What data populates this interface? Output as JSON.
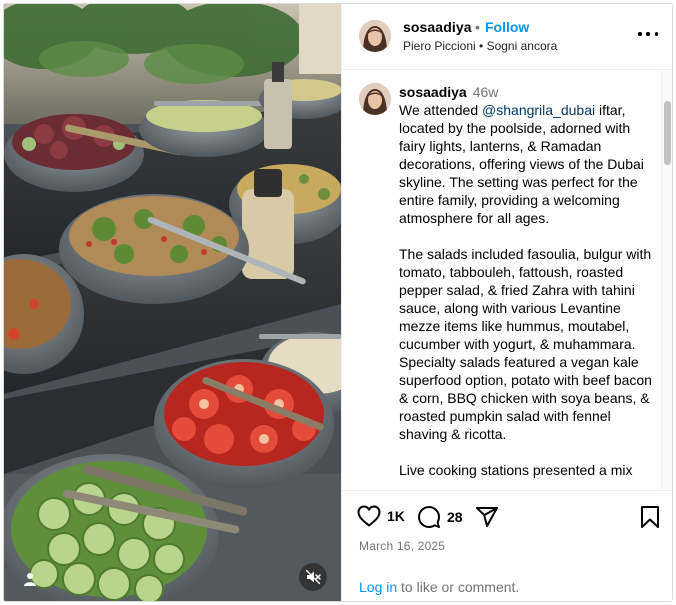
{
  "colors": {
    "link_blue": "#0095f6",
    "mention_blue": "#00376b",
    "muted_gray": "#737373",
    "border": "#dbdbdb"
  },
  "header": {
    "username": "sosaadiya",
    "separator": "•",
    "follow_label": "Follow",
    "audio": "Piero Piccioni • Sogni ancora",
    "more_icon": "more-horizontal-icon"
  },
  "caption": {
    "username": "sosaadiya",
    "time": "46w",
    "p1_before": "We attended ",
    "mention": "@shangrila_dubai",
    "p1_after": " iftar, located by the poolside, adorned with fairy lights, lanterns, & Ramadan decorations, offering views of the Dubai skyline. The setting was perfect for the entire family, providing a welcoming atmosphere for all ages.",
    "p2": "The salads included fasoulia, bulgur with tomato, tabbouleh, fattoush, roasted pepper salad, & fried Zahra with tahini sauce, along with various Levantine mezze items like hummus, moutabel, cucumber with yogurt, & muhammara. Specialty salads featured a vegan kale superfood option, potato with beef bacon & corn, BBQ chicken with soya beans, & roasted pumpkin salad with fennel shaving & ricotta.",
    "p3": "Live cooking stations presented a mix"
  },
  "actions": {
    "like_icon": "heart-icon",
    "like_count": "1K",
    "comment_icon": "comment-icon",
    "comment_count": "28",
    "share_icon": "send-icon",
    "save_icon": "bookmark-icon",
    "date": "March 16, 2025",
    "login_link": "Log in",
    "login_rest": " to like or comment."
  },
  "media": {
    "user_tag_icon": "user-tag-icon",
    "mute_icon": "muted-speaker-icon"
  }
}
